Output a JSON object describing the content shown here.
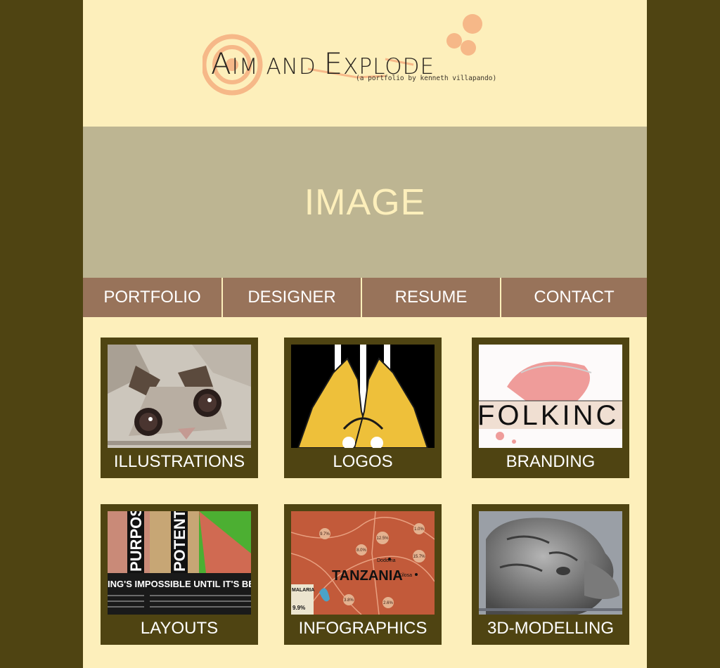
{
  "header": {
    "logo_title_a": "A",
    "logo_title_b": "IM AND ",
    "logo_title_c": "E",
    "logo_title_d": "XPLODE",
    "logo_subtitle": "(a portfolio by kenneth villapando)"
  },
  "hero": {
    "text": "IMAGE"
  },
  "nav": {
    "items": [
      {
        "label": "PORTFOLIO"
      },
      {
        "label": "DESIGNER"
      },
      {
        "label": "RESUME"
      },
      {
        "label": "CONTACT"
      }
    ]
  },
  "gallery": {
    "cards": [
      {
        "label": "ILLUSTRATIONS"
      },
      {
        "label": "LOGOS"
      },
      {
        "label": "BRANDING",
        "thumb_text": "FOLKINC"
      },
      {
        "label": "LAYOUTS",
        "thumb_words": [
          "PURPOS",
          "POTENT",
          "ING'S IMPOSSIBLE UNTIL IT'S BEEN I"
        ]
      },
      {
        "label": "INFOGRAPHICS",
        "thumb_words": [
          "TANZANIA",
          "Dodoma",
          "Kilosa",
          "MALARIA",
          "9.9%",
          "12.5%",
          "15.7%",
          "9.7%",
          "8.0%",
          "3.8%",
          "2.6%",
          "1.0%"
        ]
      },
      {
        "label": "3D-MODELLING"
      }
    ]
  },
  "colors": {
    "background": "#4f4412",
    "page": "#fdefbb",
    "hero": "#bdb592",
    "nav": "#98735a",
    "accent": "#f28a5e"
  }
}
